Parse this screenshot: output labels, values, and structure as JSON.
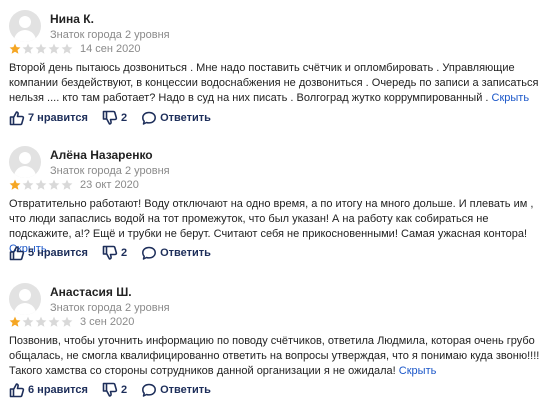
{
  "reviews": [
    {
      "author": "Нина К.",
      "level": "Знаток города 2 уровня",
      "rating": 1,
      "date": "14 сен 2020",
      "text": "Второй день пытаюсь дозвониться . Мне надо поставить счётчик и опломбировать . Управляющие компании бездействуют, в концессии водоснабжения не дозвониться . Очередь по записи а записаться нельзя .... кто там работает? Надо в суд на них писать . Волгоград жутко коррумпированный .",
      "more": "Скрыть",
      "likes": "7 нравится",
      "dislikes": "2",
      "reply": "Ответить"
    },
    {
      "author": "Алёна Назаренко",
      "level": "Знаток города 2 уровня",
      "rating": 1,
      "date": "23 окт 2020",
      "text": "Отвратительно работают! Воду отключают на одно время, а по итогу на много дольше. И плевать им , что люди запаслись водой на тот промежуток, что был указан! А на работу как собираться не подскажите, а!? Ещё и трубки не берут. Считают себя не прикосновенными! Самая ужасная контора!",
      "more": "Скрыть",
      "likes": "5 нравится",
      "dislikes": "2",
      "reply": "Ответить"
    },
    {
      "author": "Анастасия Ш.",
      "level": "Знаток города 2 уровня",
      "rating": 1,
      "date": "3 сен 2020",
      "text": "Позвонив, чтобы уточнить информацию по поводу счётчиков, ответила Людмила, которая очень грубо общалась, не смогла квалифицированно ответить на вопросы утверждая, что я понимаю куда звоню!!!! Такого хамства со стороны сотрудников данной организации я не ожидала!",
      "more": "Скрыть",
      "likes": "6 нравится",
      "dislikes": "2",
      "reply": "Ответить"
    }
  ],
  "colors": {
    "star_filled": "#f5a623",
    "star_empty": "#d9d9d9",
    "link": "#1a56c8",
    "action": "#1d2e5a"
  }
}
